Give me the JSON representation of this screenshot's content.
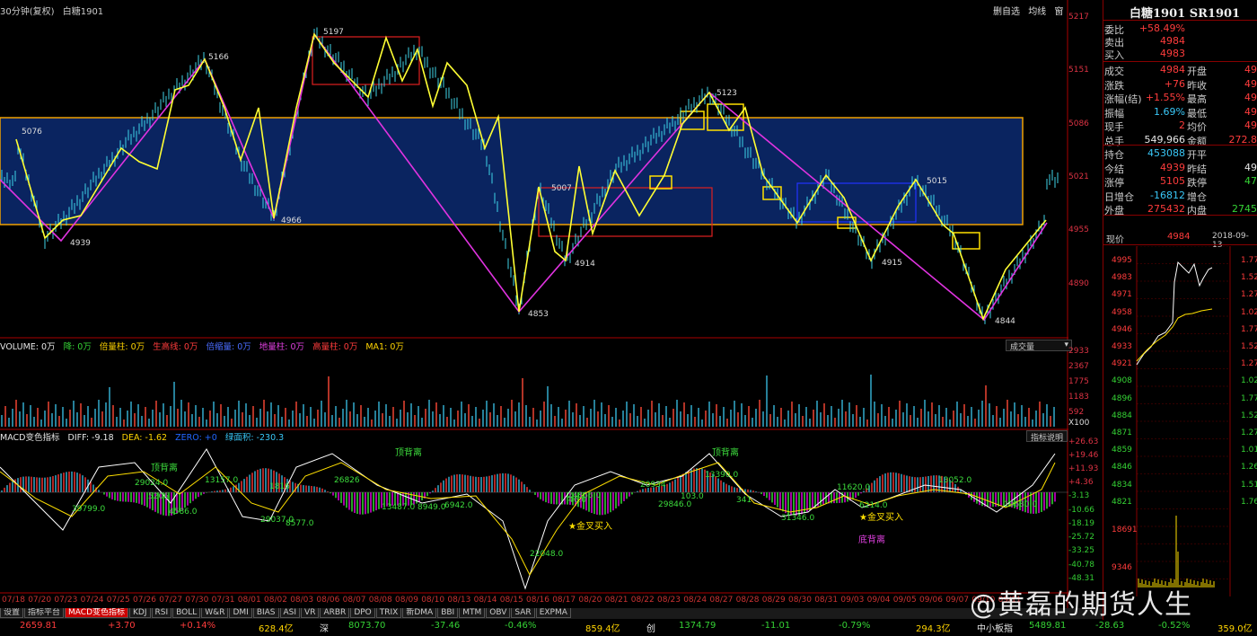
{
  "header": {
    "period": "30分钟(复权)",
    "symbol": "白糖1901",
    "buttons": [
      "删自选",
      "均线",
      "窗"
    ]
  },
  "main_chart": {
    "price_levels": [
      "5217",
      "5151",
      "5086",
      "5021",
      "4955",
      "4890"
    ],
    "annotations": [
      "5076",
      "5166",
      "5197",
      "4939",
      "4966",
      "5123",
      "5007",
      "4914",
      "4853",
      "5015",
      "4915",
      "4844"
    ]
  },
  "volume_panel": {
    "label": "VOLUME: 0万",
    "items": [
      "降: 0万",
      "倍量柱: 0万",
      "生高线: 0万",
      "倍缩量: 0万",
      "地量柱: 0万",
      "高量柱: 0万",
      "MA1: 0万"
    ],
    "dropdown": "成交量",
    "axis": [
      "2933",
      "2367",
      "1775",
      "1183",
      "592",
      "X100"
    ],
    "marks": [
      "高",
      "倍"
    ]
  },
  "macd_panel": {
    "label": "MACD变色指标",
    "diff": "DIFF: -9.18",
    "dea": "DEA: -1.62",
    "zero": "ZERO: +0",
    "area": "绿面积: -230.3",
    "help_button": "指标说明",
    "axis": [
      "+26.63",
      "+19.46",
      "+11.93",
      "+4.36",
      "-3.13",
      "-10.66",
      "-18.19",
      "-25.72",
      "-33.25",
      "-40.78",
      "-48.31"
    ],
    "notes": [
      "顶背离",
      "顶背离",
      "顶背离",
      "底背离",
      "金叉买入",
      "金叉买入"
    ],
    "numbers": [
      "29024.0",
      "39799.0",
      "5206",
      "4586.0",
      "13157.0",
      "1816",
      "29037.0",
      "8577.0",
      "26826",
      "13487.0",
      "8949.0",
      "6942.0",
      "22048.0",
      "24866.0",
      "46.0",
      "20934",
      "29846.0",
      "103.0",
      "13390.0",
      "341",
      "11620.0",
      "31346.0",
      "6214.0",
      "13052.0",
      "19680.0"
    ]
  },
  "x_dates": [
    "07/18",
    "07/20",
    "07/23",
    "07/24",
    "07/25",
    "07/26",
    "07/27",
    "07/30",
    "07/31",
    "08/01",
    "08/02",
    "08/03",
    "08/06",
    "08/07",
    "08/08",
    "08/09",
    "08/10",
    "08/13",
    "08/14",
    "08/15",
    "08/16",
    "08/17",
    "08/20",
    "08/21",
    "08/22",
    "08/23",
    "08/24",
    "08/27",
    "08/28",
    "08/29",
    "08/30",
    "08/31",
    "09/03",
    "09/04",
    "09/05",
    "09/06",
    "09/07",
    "09/10",
    "09/11"
  ],
  "tabs": [
    "设置",
    "指标平台",
    "MACD变色指标",
    "KDJ",
    "RSI",
    "BOLL",
    "W&R",
    "DMI",
    "BIAS",
    "ASI",
    "VR",
    "ARBR",
    "DPO",
    "TRIX",
    "新DMA",
    "BBI",
    "MTM",
    "OBV",
    "SAR",
    "EXPMA"
  ],
  "status_bar": {
    "index1_value": "2659.81",
    "index1_change": "+3.70",
    "index1_pct": "+0.14%",
    "index1_amount": "628.4亿",
    "sz_label": "深",
    "sz_value": "8073.70",
    "sz_change": "-37.46",
    "sz_pct": "-0.46%",
    "sz_amount": "859.4亿",
    "cy_label": "创",
    "cy_value": "1374.79",
    "cy_change": "-11.01",
    "cy_pct": "-0.79%",
    "cy_amount": "294.3亿",
    "zx_label": "中小板指",
    "zx_value": "5489.81",
    "zx_change": "-28.63",
    "zx_pct": "-0.52%",
    "zx_amount": "359.0亿"
  },
  "quote_panel": {
    "title": "白糖1901 SR1901",
    "rows1": [
      {
        "label": "委比",
        "value": "+58.49%"
      },
      {
        "label": "卖出",
        "value": "4984"
      },
      {
        "label": "买入",
        "value": "4983"
      }
    ],
    "rows2": [
      {
        "l1": "成交",
        "v1": "4984",
        "l2": "开盘",
        "v2": "49"
      },
      {
        "l1": "涨跌",
        "v1": "+76",
        "l2": "昨收",
        "v2": "49"
      },
      {
        "l1": "涨幅(结)",
        "v1": "+1.55%",
        "l2": "最高",
        "v2": "49"
      },
      {
        "l1": "振幅",
        "v1": "1.69%",
        "l2": "最低",
        "v2": "49"
      },
      {
        "l1": "现手",
        "v1": "2",
        "l2": "均价",
        "v2": "49"
      },
      {
        "l1": "总手",
        "v1": "549,966",
        "l2": "金额",
        "v2": "272.8"
      }
    ],
    "rows3": [
      {
        "l1": "持仓",
        "v1": "453088",
        "l2": "开平",
        "v2": ""
      },
      {
        "l1": "今结",
        "v1": "4939",
        "l2": "昨结",
        "v2": "49"
      },
      {
        "l1": "涨停",
        "v1": "5105",
        "l2": "跌停",
        "v2": "47"
      },
      {
        "l1": "日增仓",
        "v1": "-16812",
        "l2": "增仓",
        "v2": ""
      },
      {
        "l1": "外盘",
        "v1": "275432",
        "l2": "内盘",
        "v2": "2745"
      }
    ],
    "current_label": "现价",
    "current_value": "4984",
    "date": "2018-09-13",
    "mini_left_axis": [
      "4995",
      "4983",
      "4971",
      "4958",
      "4946",
      "4933",
      "4921",
      "4908",
      "4896",
      "4884",
      "4871",
      "4859",
      "4846",
      "4834",
      "4821"
    ],
    "mini_right_axis": [
      "1.77",
      "1.52",
      "1.27",
      "1.02",
      "1.77",
      "1.52",
      "1.27",
      "1.02",
      "1.77",
      "1.52",
      "1.27",
      "1.01",
      "1.26",
      "1.51",
      "1.76"
    ],
    "vol_axis": [
      "18691",
      "9346"
    ]
  },
  "watermark": "@黄磊的期货人生"
}
